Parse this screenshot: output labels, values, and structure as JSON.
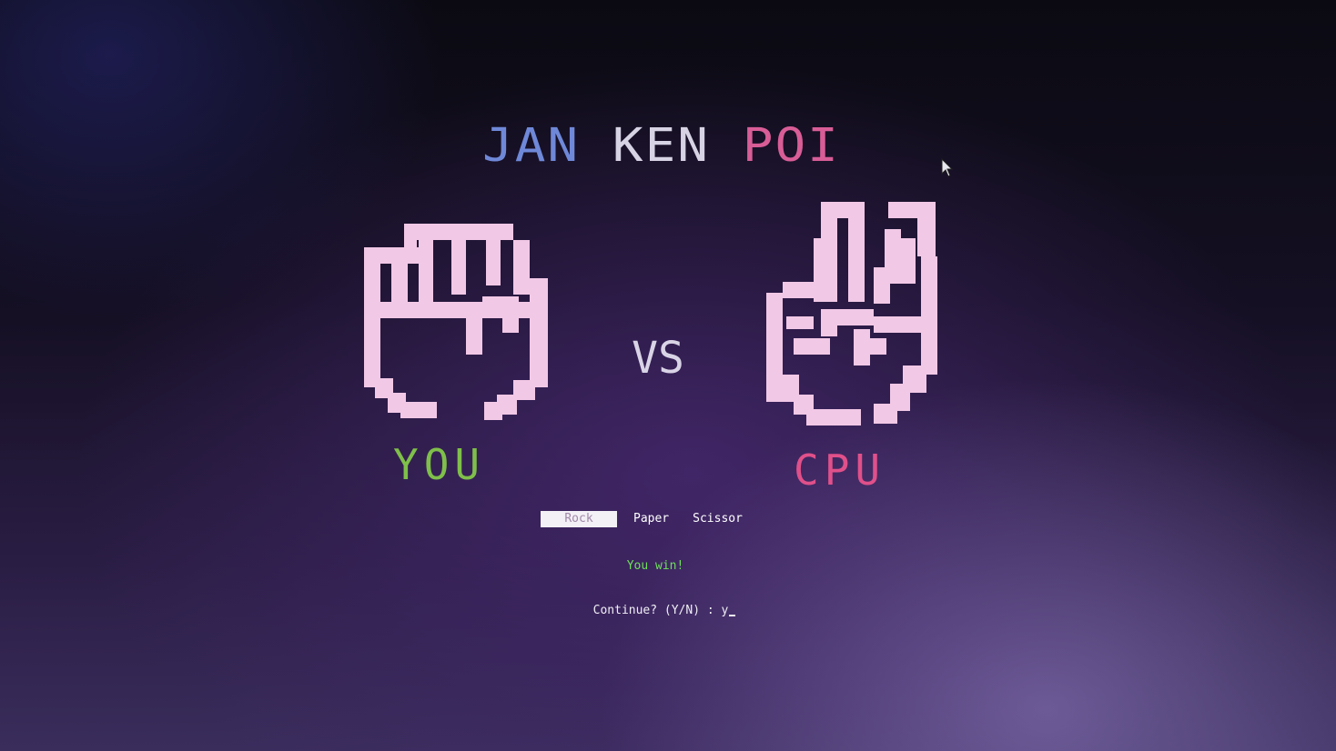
{
  "title": {
    "word1": "JAN",
    "word2": "KEN",
    "word3": "POI"
  },
  "players": {
    "you": {
      "label": "YOU",
      "hand": "rock"
    },
    "cpu": {
      "label": "CPU",
      "hand": "scissor"
    }
  },
  "vs_label": "VS",
  "menu": {
    "items": [
      "Rock",
      "Paper",
      "Scissor"
    ],
    "selected": "Rock"
  },
  "result_text": "You win!",
  "prompt": {
    "text": "Continue? (Y/N) : ",
    "input_value": "y"
  },
  "colors": {
    "title_word1": "#6f88d8",
    "title_word2": "#d7d2e4",
    "title_word3": "#d85d97",
    "you_label": "#7fbf4a",
    "cpu_label": "#e0508a",
    "hand": "#f1c8e6",
    "vs": "#d9d3e6",
    "selected_bg": "#f3f0f6",
    "result": "#6ee05a",
    "prompt": "#f0eef4"
  },
  "icons": {
    "you_hand": "rock-fist-icon",
    "cpu_hand": "peace-scissor-icon",
    "mouse": "mouse-pointer-icon"
  }
}
